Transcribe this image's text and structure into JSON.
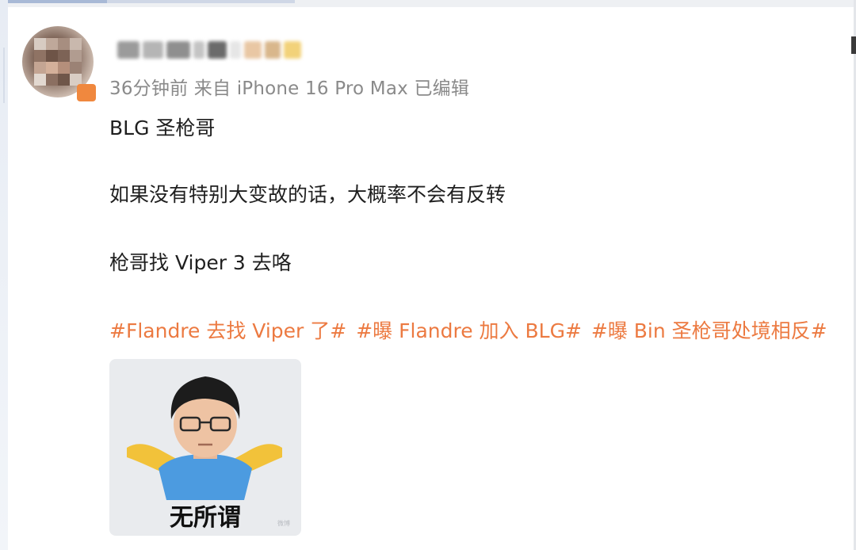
{
  "post": {
    "meta": "36分钟前 来自 iPhone 16 Pro Max 已编辑",
    "lines": [
      "BLG  圣枪哥",
      "如果没有特别大变故的话，大概率不会有反转",
      "枪哥找 Viper 3 去咯"
    ],
    "tags": [
      "#Flandre 去找 Viper 了#",
      "#曝 Flandre 加入 BLG#",
      "#曝 Bin 圣枪哥处境相反#"
    ]
  },
  "image": {
    "caption": "无所谓",
    "watermark": "微博"
  },
  "colors": {
    "tag": "#ec7a41",
    "meta": "#8a8a8a",
    "text": "#1f1f1f",
    "badge": "#f0883e"
  }
}
